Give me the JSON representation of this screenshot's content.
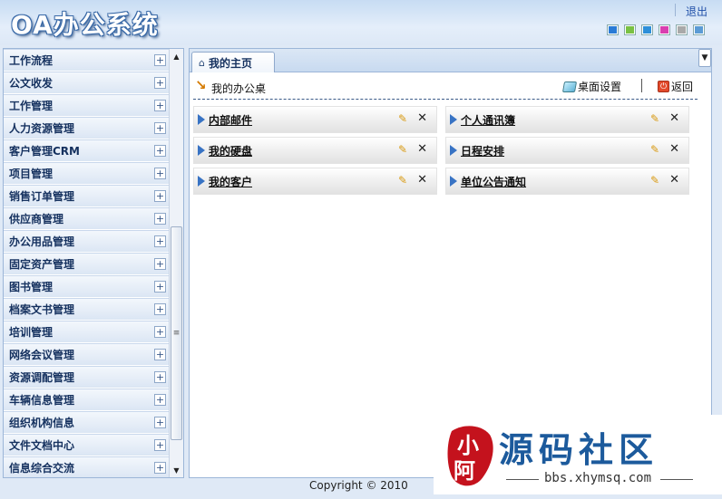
{
  "header": {
    "logo": "OA办公系统",
    "logout_label": "退出",
    "skin_colors": [
      "#2a7bd6",
      "#7ac143",
      "#2d8fd9",
      "#d93fb0",
      "#a9a9a9",
      "#5b9bd5"
    ]
  },
  "sidebar": {
    "items": [
      {
        "label": "工作流程"
      },
      {
        "label": "公文收发"
      },
      {
        "label": "工作管理"
      },
      {
        "label": "人力资源管理"
      },
      {
        "label": "客户管理CRM"
      },
      {
        "label": "项目管理"
      },
      {
        "label": "销售订单管理"
      },
      {
        "label": "供应商管理"
      },
      {
        "label": "办公用品管理"
      },
      {
        "label": "固定资产管理"
      },
      {
        "label": "图书管理"
      },
      {
        "label": "档案文书管理"
      },
      {
        "label": "培训管理"
      },
      {
        "label": "网络会议管理"
      },
      {
        "label": "资源调配管理"
      },
      {
        "label": "车辆信息管理"
      },
      {
        "label": "组织机构信息"
      },
      {
        "label": "文件文档中心"
      },
      {
        "label": "信息综合交流"
      }
    ]
  },
  "main": {
    "tab_label": "我的主页",
    "desk_title": "我的办公桌",
    "settings_label": "桌面设置",
    "back_label": "返回",
    "modules": [
      {
        "label": "内部邮件"
      },
      {
        "label": "个人通讯簿"
      },
      {
        "label": "我的硬盘"
      },
      {
        "label": "日程安排"
      },
      {
        "label": "我的客户"
      },
      {
        "label": "单位公告通知"
      }
    ]
  },
  "footer": {
    "copyright": "Copyright © 2010"
  },
  "watermark": {
    "seal_text": "小阿",
    "title": "源码社区",
    "url": "bbs.xhymsq.com"
  }
}
